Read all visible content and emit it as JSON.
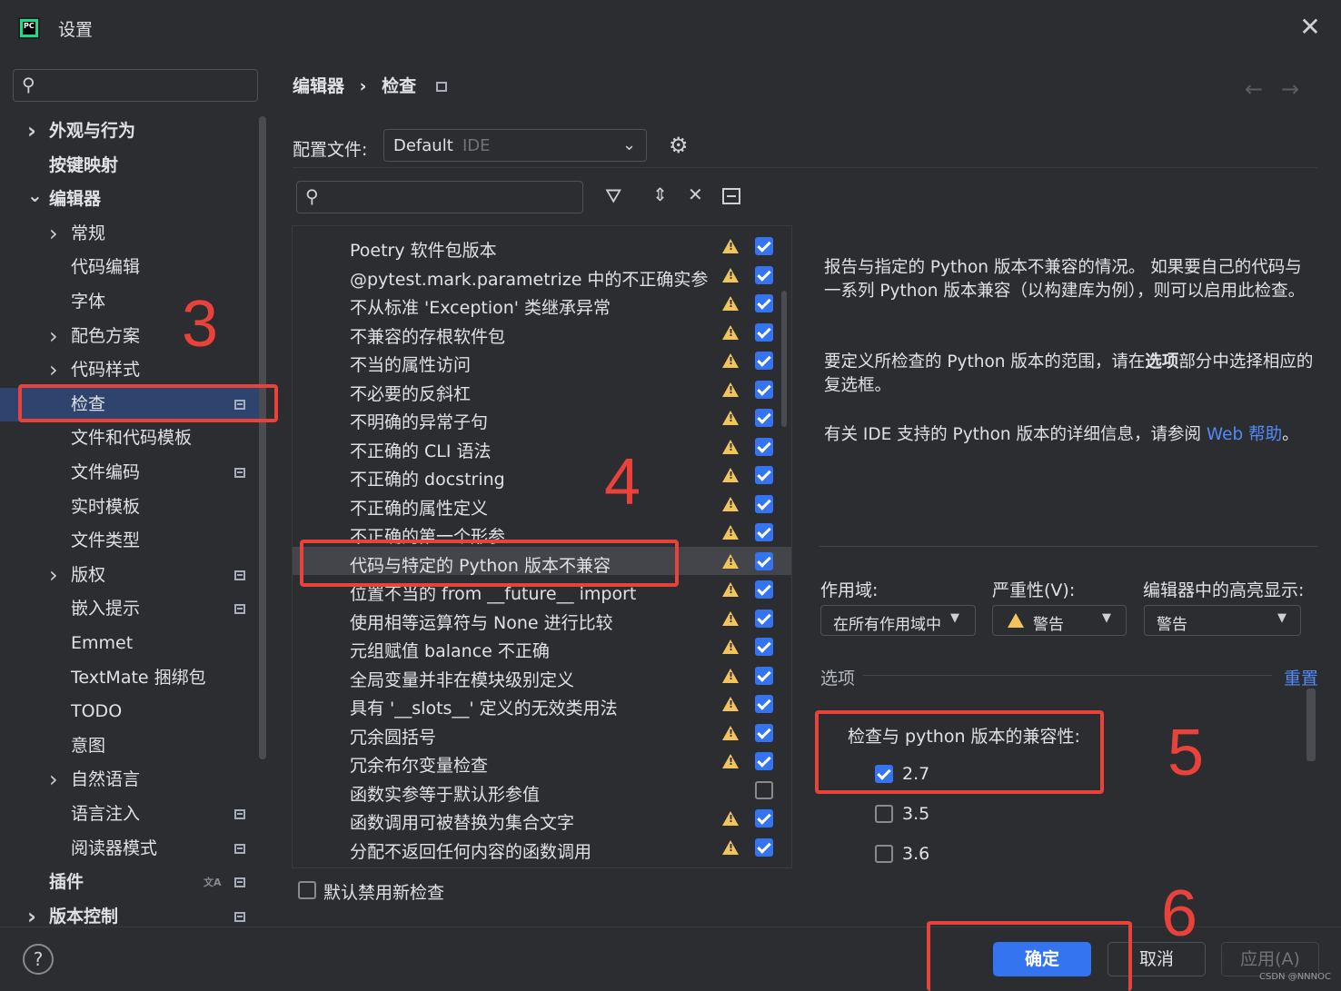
{
  "window": {
    "title": "设置",
    "app_icon": "pycharm-icon",
    "app_icon_text": "PC"
  },
  "sidebar": {
    "search_placeholder": "",
    "items": [
      {
        "label": "外观与行为",
        "bold": true,
        "chevron": "right"
      },
      {
        "label": "按键映射",
        "bold": true
      },
      {
        "label": "编辑器",
        "bold": true,
        "chevron": "down"
      },
      {
        "label": "常规",
        "chevron": "right"
      },
      {
        "label": "代码编辑"
      },
      {
        "label": "字体"
      },
      {
        "label": "配色方案",
        "chevron": "right"
      },
      {
        "label": "代码样式",
        "chevron": "right"
      },
      {
        "label": "检查",
        "selected": true,
        "project_icon": true
      },
      {
        "label": "文件和代码模板"
      },
      {
        "label": "文件编码",
        "project_icon": true
      },
      {
        "label": "实时模板"
      },
      {
        "label": "文件类型"
      },
      {
        "label": "版权",
        "chevron": "right",
        "project_icon": true
      },
      {
        "label": "嵌入提示",
        "project_icon": true
      },
      {
        "label": "Emmet"
      },
      {
        "label": "TextMate 捆绑包"
      },
      {
        "label": "TODO"
      },
      {
        "label": "意图"
      },
      {
        "label": "自然语言",
        "chevron": "right"
      },
      {
        "label": "语言注入",
        "project_icon": true
      },
      {
        "label": "阅读器模式",
        "project_icon": true
      },
      {
        "label": "插件",
        "bold": true,
        "project_icon": true,
        "translate_icon": true
      },
      {
        "label": "版本控制",
        "bold": true,
        "chevron": "right",
        "project_icon": true
      }
    ]
  },
  "header": {
    "crumb_parent": "编辑器",
    "crumb_sep": "›",
    "crumb_current": "检查"
  },
  "profile": {
    "label": "配置文件:",
    "value": "Default",
    "value_suffix": "IDE"
  },
  "inspections": {
    "search_placeholder": "",
    "rows": [
      {
        "label": "Poetry 软件包版本",
        "checked": true
      },
      {
        "label": "@pytest.mark.parametrize 中的不正确实参",
        "checked": true
      },
      {
        "label": "不从标准 'Exception' 类继承异常",
        "checked": true
      },
      {
        "label": "不兼容的存根软件包",
        "checked": true
      },
      {
        "label": "不当的属性访问",
        "checked": true
      },
      {
        "label": "不必要的反斜杠",
        "checked": true
      },
      {
        "label": "不明确的异常子句",
        "checked": true
      },
      {
        "label": "不正确的 CLI 语法",
        "checked": true
      },
      {
        "label": "不正确的 docstring",
        "checked": true
      },
      {
        "label": "不正确的属性定义",
        "checked": true
      },
      {
        "label": "不正确的第一个形参",
        "checked": true
      },
      {
        "label": "代码与特定的 Python 版本不兼容",
        "checked": true,
        "selected": true
      },
      {
        "label": "位置不当的 from __future__ import",
        "checked": true
      },
      {
        "label": "使用相等运算符与 None 进行比较",
        "checked": true
      },
      {
        "label": "元组赋值 balance 不正确",
        "checked": true
      },
      {
        "label": "全局变量并非在模块级别定义",
        "checked": true
      },
      {
        "label": "具有 '__slots__' 定义的无效类用法",
        "checked": true
      },
      {
        "label": "冗余圆括号",
        "checked": true
      },
      {
        "label": "冗余布尔变量检查",
        "checked": true
      },
      {
        "label": "函数实参等于默认形参值",
        "checked": false,
        "no_warn": true
      },
      {
        "label": "函数调用可被替换为集合文字",
        "checked": true
      },
      {
        "label": "分配不返回任何内容的函数调用",
        "checked": true
      }
    ],
    "disable_new_label": "默认禁用新检查"
  },
  "description": {
    "p1": "报告与指定的 Python 版本不兼容的情况。 如果要自己的代码与一系列 Python 版本兼容（以构建库为例），则可以启用此检查。",
    "p2_before": "要定义所检查的 Python 版本的范围，请在",
    "p2_bold": "选项",
    "p2_after": "部分中选择相应的复选框。",
    "p3_before": "有关 IDE 支持的 Python 版本的详细信息，请参阅 ",
    "p3_link": "Web 帮助",
    "p3_after": "。"
  },
  "settings": {
    "scope_label": "作用域:",
    "scope_value": "在所有作用域中",
    "severity_label": "严重性(V):",
    "severity_value": "警告",
    "highlight_label": "编辑器中的高亮显示:",
    "highlight_value": "警告",
    "options_label": "选项",
    "reset_label": "重置",
    "compat_label": "检查与 python 版本的兼容性:",
    "versions": [
      {
        "label": "2.7",
        "checked": true
      },
      {
        "label": "3.5",
        "checked": false
      },
      {
        "label": "3.6",
        "checked": false
      }
    ]
  },
  "footer": {
    "ok": "确定",
    "cancel": "取消",
    "apply": "应用(A)",
    "help": "?"
  },
  "annotations": [
    "3",
    "4",
    "5",
    "6"
  ],
  "watermark": "CSDN @NNNOC",
  "colors": {
    "accent": "#3574f0",
    "annotation": "#e8423a",
    "warning": "#f2c55c",
    "background": "#2b2d30"
  }
}
